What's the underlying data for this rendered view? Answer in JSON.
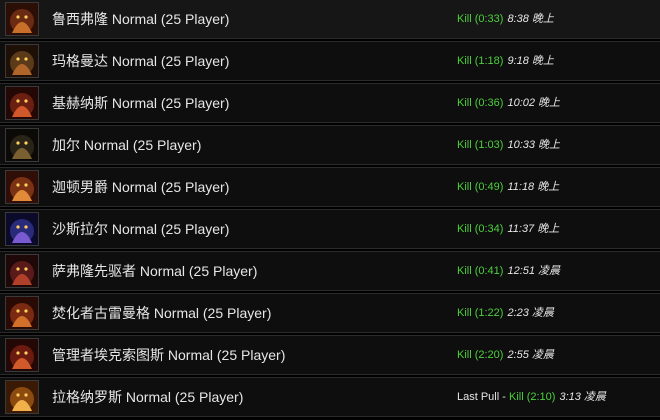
{
  "encounters": [
    {
      "name": "鲁西弗隆 Normal (25 Player)",
      "result": "Kill (0:33)",
      "time": "8:38 晚上",
      "icon": "lucifron-icon",
      "colors": [
        "#6b2a12",
        "#c8702a",
        "#2b0f06"
      ]
    },
    {
      "name": "玛格曼达 Normal (25 Player)",
      "result": "Kill (1:18)",
      "time": "9:18 晚上",
      "icon": "magmadar-icon",
      "colors": [
        "#5a3a18",
        "#b0662a",
        "#1e1006"
      ]
    },
    {
      "name": "基赫纳斯 Normal (25 Player)",
      "result": "Kill (0:36)",
      "time": "10:02 晚上",
      "icon": "gehennas-icon",
      "colors": [
        "#6a1f10",
        "#d0582a",
        "#240806"
      ]
    },
    {
      "name": "加尔 Normal (25 Player)",
      "result": "Kill (1:03)",
      "time": "10:33 晚上",
      "icon": "garr-icon",
      "colors": [
        "#2a2318",
        "#7a6030",
        "#0c0a06"
      ]
    },
    {
      "name": "迦顿男爵 Normal (25 Player)",
      "result": "Kill (0:49)",
      "time": "11:18 晚上",
      "icon": "geddon-icon",
      "colors": [
        "#7a3212",
        "#e08a3a",
        "#2e0e06"
      ]
    },
    {
      "name": "沙斯拉尔 Normal (25 Player)",
      "result": "Kill (0:34)",
      "time": "11:37 晚上",
      "icon": "shazzrah-icon",
      "colors": [
        "#2a2a7a",
        "#7a5ad0",
        "#0c0a2a"
      ]
    },
    {
      "name": "萨弗隆先驱者 Normal (25 Player)",
      "result": "Kill (0:41)",
      "time": "12:51 凌晨",
      "icon": "harbinger-icon",
      "colors": [
        "#5a1a1a",
        "#b0402a",
        "#1e0808"
      ]
    },
    {
      "name": "焚化者古雷曼格 Normal (25 Player)",
      "result": "Kill (1:22)",
      "time": "2:23 凌晨",
      "icon": "golemagg-icon",
      "colors": [
        "#7a2a10",
        "#d0702a",
        "#2a0a04"
      ]
    },
    {
      "name": "管理者埃克索图斯 Normal (25 Player)",
      "result": "Kill (2:20)",
      "time": "2:55 凌晨",
      "icon": "executus-icon",
      "colors": [
        "#6a1a0e",
        "#d05a2a",
        "#240806"
      ]
    },
    {
      "name": "拉格纳罗斯 Normal (25 Player)",
      "result_prefix": "Last Pull",
      "separator": " - ",
      "result": "Kill (2:10)",
      "time": "3:13 凌晨",
      "icon": "ragnaros-icon",
      "colors": [
        "#8a4a10",
        "#f0b04a",
        "#3a1a04"
      ]
    }
  ]
}
